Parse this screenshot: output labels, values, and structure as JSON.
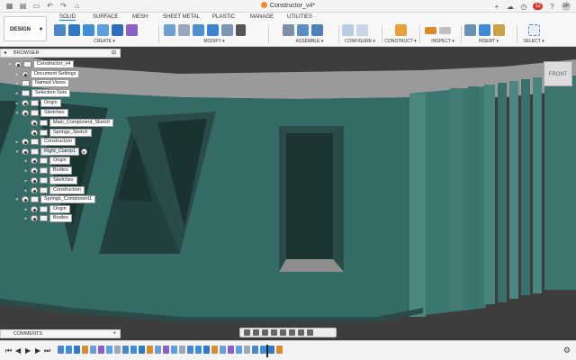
{
  "window": {
    "title": "Constructor_v4*",
    "notifications": "12",
    "avatar_initials": "DP",
    "icons": [
      "grid-icon",
      "save-icon",
      "undo-icon",
      "redo-icon",
      "home-icon",
      "plus-icon",
      "cloud-icon",
      "clock-icon",
      "bell-icon",
      "help-icon"
    ]
  },
  "toolbar": {
    "workspace_label": "DESIGN",
    "tabs": [
      "SOLID",
      "SURFACE",
      "MESH",
      "SHEET METAL",
      "PLASTIC",
      "MANAGE",
      "UTILITIES"
    ],
    "active_tab": "SOLID",
    "groups": [
      {
        "label": "CREATE ▾"
      },
      {
        "label": "MODIFY ▾"
      },
      {
        "label": "ASSEMBLE ▾"
      },
      {
        "label": "CONFIGURE ▾"
      },
      {
        "label": "CONSTRUCT ▾"
      },
      {
        "label": "INSPECT ▾"
      },
      {
        "label": "INSERT ▾"
      },
      {
        "label": "SELECT ▾"
      }
    ]
  },
  "viewcube": {
    "label": "FRONT"
  },
  "browser": {
    "title": "BROWSER",
    "nodes": [
      {
        "label": "Constructor_v4",
        "depth": 0
      },
      {
        "label": "Document Settings",
        "depth": 1
      },
      {
        "label": "Named Views",
        "depth": 1
      },
      {
        "label": "Selection Sets",
        "depth": 1
      },
      {
        "label": "Origin",
        "depth": 1
      },
      {
        "label": "Sketches",
        "depth": 1
      },
      {
        "label": "Main_Component_Sketch",
        "depth": 2
      },
      {
        "label": "Springs_Sketch",
        "depth": 2
      },
      {
        "label": "Construction",
        "depth": 1
      },
      {
        "label": "Right_Clamp1",
        "depth": 1
      },
      {
        "label": "Origin",
        "depth": 2
      },
      {
        "label": "Bodies",
        "depth": 2
      },
      {
        "label": "Sketches",
        "depth": 2
      },
      {
        "label": "Construction",
        "depth": 2
      },
      {
        "label": "Springs_Component1",
        "depth": 1
      },
      {
        "label": "Origin",
        "depth": 2
      },
      {
        "label": "Bodies",
        "depth": 2
      }
    ]
  },
  "comments": {
    "title": "COMMENTS"
  },
  "colors": {
    "model": "#356b66",
    "model_dark": "#22403d",
    "background": "#3d3d3d",
    "accent": "#0a84d8"
  }
}
